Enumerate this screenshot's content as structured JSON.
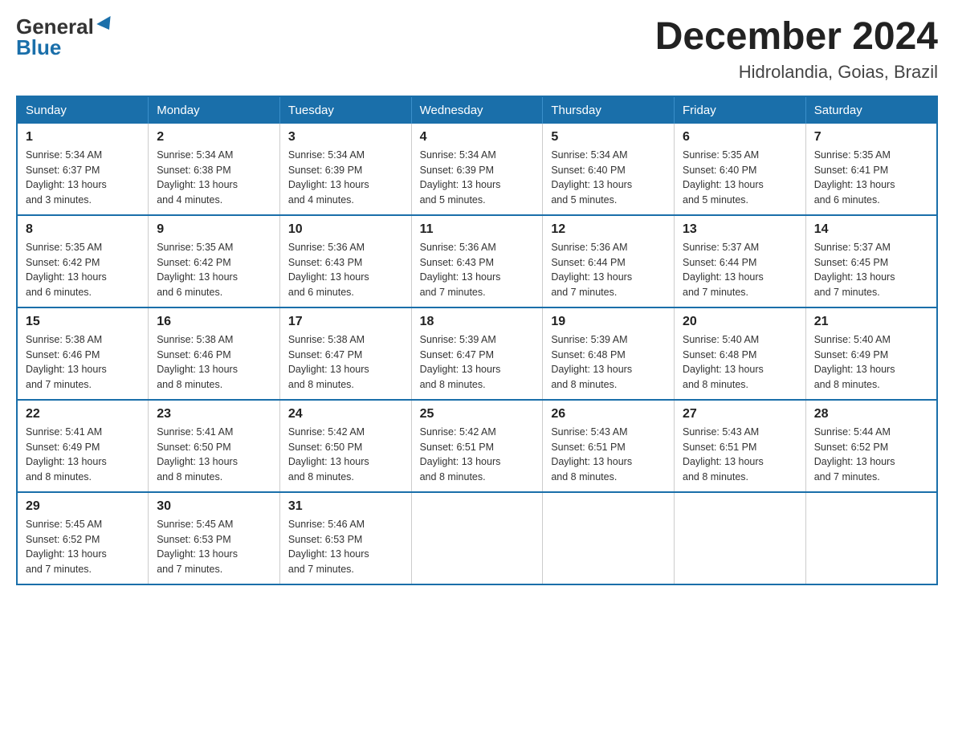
{
  "header": {
    "logo_general": "General",
    "logo_blue": "Blue",
    "month_title": "December 2024",
    "location": "Hidrolandia, Goias, Brazil"
  },
  "days_of_week": [
    "Sunday",
    "Monday",
    "Tuesday",
    "Wednesday",
    "Thursday",
    "Friday",
    "Saturday"
  ],
  "weeks": [
    [
      {
        "day": "1",
        "sunrise": "5:34 AM",
        "sunset": "6:37 PM",
        "daylight": "13 hours and 3 minutes."
      },
      {
        "day": "2",
        "sunrise": "5:34 AM",
        "sunset": "6:38 PM",
        "daylight": "13 hours and 4 minutes."
      },
      {
        "day": "3",
        "sunrise": "5:34 AM",
        "sunset": "6:39 PM",
        "daylight": "13 hours and 4 minutes."
      },
      {
        "day": "4",
        "sunrise": "5:34 AM",
        "sunset": "6:39 PM",
        "daylight": "13 hours and 5 minutes."
      },
      {
        "day": "5",
        "sunrise": "5:34 AM",
        "sunset": "6:40 PM",
        "daylight": "13 hours and 5 minutes."
      },
      {
        "day": "6",
        "sunrise": "5:35 AM",
        "sunset": "6:40 PM",
        "daylight": "13 hours and 5 minutes."
      },
      {
        "day": "7",
        "sunrise": "5:35 AM",
        "sunset": "6:41 PM",
        "daylight": "13 hours and 6 minutes."
      }
    ],
    [
      {
        "day": "8",
        "sunrise": "5:35 AM",
        "sunset": "6:42 PM",
        "daylight": "13 hours and 6 minutes."
      },
      {
        "day": "9",
        "sunrise": "5:35 AM",
        "sunset": "6:42 PM",
        "daylight": "13 hours and 6 minutes."
      },
      {
        "day": "10",
        "sunrise": "5:36 AM",
        "sunset": "6:43 PM",
        "daylight": "13 hours and 6 minutes."
      },
      {
        "day": "11",
        "sunrise": "5:36 AM",
        "sunset": "6:43 PM",
        "daylight": "13 hours and 7 minutes."
      },
      {
        "day": "12",
        "sunrise": "5:36 AM",
        "sunset": "6:44 PM",
        "daylight": "13 hours and 7 minutes."
      },
      {
        "day": "13",
        "sunrise": "5:37 AM",
        "sunset": "6:44 PM",
        "daylight": "13 hours and 7 minutes."
      },
      {
        "day": "14",
        "sunrise": "5:37 AM",
        "sunset": "6:45 PM",
        "daylight": "13 hours and 7 minutes."
      }
    ],
    [
      {
        "day": "15",
        "sunrise": "5:38 AM",
        "sunset": "6:46 PM",
        "daylight": "13 hours and 7 minutes."
      },
      {
        "day": "16",
        "sunrise": "5:38 AM",
        "sunset": "6:46 PM",
        "daylight": "13 hours and 8 minutes."
      },
      {
        "day": "17",
        "sunrise": "5:38 AM",
        "sunset": "6:47 PM",
        "daylight": "13 hours and 8 minutes."
      },
      {
        "day": "18",
        "sunrise": "5:39 AM",
        "sunset": "6:47 PM",
        "daylight": "13 hours and 8 minutes."
      },
      {
        "day": "19",
        "sunrise": "5:39 AM",
        "sunset": "6:48 PM",
        "daylight": "13 hours and 8 minutes."
      },
      {
        "day": "20",
        "sunrise": "5:40 AM",
        "sunset": "6:48 PM",
        "daylight": "13 hours and 8 minutes."
      },
      {
        "day": "21",
        "sunrise": "5:40 AM",
        "sunset": "6:49 PM",
        "daylight": "13 hours and 8 minutes."
      }
    ],
    [
      {
        "day": "22",
        "sunrise": "5:41 AM",
        "sunset": "6:49 PM",
        "daylight": "13 hours and 8 minutes."
      },
      {
        "day": "23",
        "sunrise": "5:41 AM",
        "sunset": "6:50 PM",
        "daylight": "13 hours and 8 minutes."
      },
      {
        "day": "24",
        "sunrise": "5:42 AM",
        "sunset": "6:50 PM",
        "daylight": "13 hours and 8 minutes."
      },
      {
        "day": "25",
        "sunrise": "5:42 AM",
        "sunset": "6:51 PM",
        "daylight": "13 hours and 8 minutes."
      },
      {
        "day": "26",
        "sunrise": "5:43 AM",
        "sunset": "6:51 PM",
        "daylight": "13 hours and 8 minutes."
      },
      {
        "day": "27",
        "sunrise": "5:43 AM",
        "sunset": "6:51 PM",
        "daylight": "13 hours and 8 minutes."
      },
      {
        "day": "28",
        "sunrise": "5:44 AM",
        "sunset": "6:52 PM",
        "daylight": "13 hours and 7 minutes."
      }
    ],
    [
      {
        "day": "29",
        "sunrise": "5:45 AM",
        "sunset": "6:52 PM",
        "daylight": "13 hours and 7 minutes."
      },
      {
        "day": "30",
        "sunrise": "5:45 AM",
        "sunset": "6:53 PM",
        "daylight": "13 hours and 7 minutes."
      },
      {
        "day": "31",
        "sunrise": "5:46 AM",
        "sunset": "6:53 PM",
        "daylight": "13 hours and 7 minutes."
      },
      null,
      null,
      null,
      null
    ]
  ],
  "labels": {
    "sunrise": "Sunrise:",
    "sunset": "Sunset:",
    "daylight": "Daylight:"
  }
}
